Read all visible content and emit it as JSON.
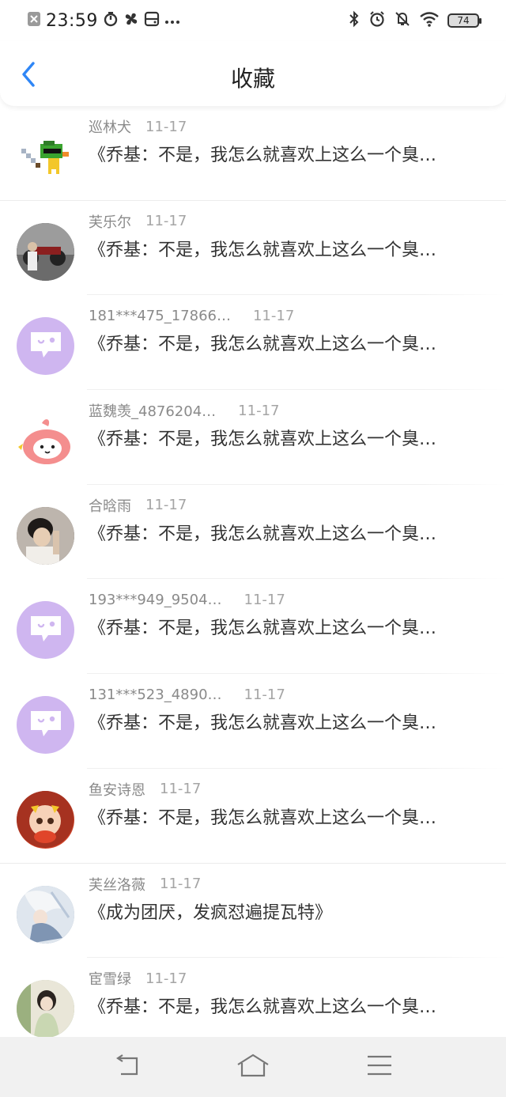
{
  "status_bar": {
    "time": "23:59",
    "battery": "74"
  },
  "nav": {
    "title": "收藏"
  },
  "items": [
    {
      "user": "巡林犬",
      "date": "11-17",
      "snippet": "《乔基：不是，我怎么就喜欢上这么一个臭…"
    },
    {
      "user": "芙乐尔",
      "date": "11-17",
      "snippet": "《乔基：不是，我怎么就喜欢上这么一个臭…"
    },
    {
      "user": "181***475_17866…",
      "date": "11-17",
      "snippet": "《乔基：不是，我怎么就喜欢上这么一个臭…"
    },
    {
      "user": "蓝魏羡_4876204…",
      "date": "11-17",
      "snippet": "《乔基：不是，我怎么就喜欢上这么一个臭…"
    },
    {
      "user": "合晗雨",
      "date": "11-17",
      "snippet": "《乔基：不是，我怎么就喜欢上这么一个臭…"
    },
    {
      "user": "193***949_9504…",
      "date": "11-17",
      "snippet": "《乔基：不是，我怎么就喜欢上这么一个臭…"
    },
    {
      "user": "131***523_4890…",
      "date": "11-17",
      "snippet": "《乔基：不是，我怎么就喜欢上这么一个臭…"
    },
    {
      "user": "鱼安诗恩",
      "date": "11-17",
      "snippet": "《乔基：不是，我怎么就喜欢上这么一个臭…"
    },
    {
      "user": "芙丝洛薇",
      "date": "11-17",
      "snippet": "《成为团厌，发疯怼遍提瓦特》"
    },
    {
      "user": "宦雪绿",
      "date": "11-17",
      "snippet": "《乔基：不是，我怎么就喜欢上这么一个臭…"
    }
  ],
  "colors": {
    "accent": "#2f86f6",
    "default_avatar": "#cfb6f0"
  }
}
